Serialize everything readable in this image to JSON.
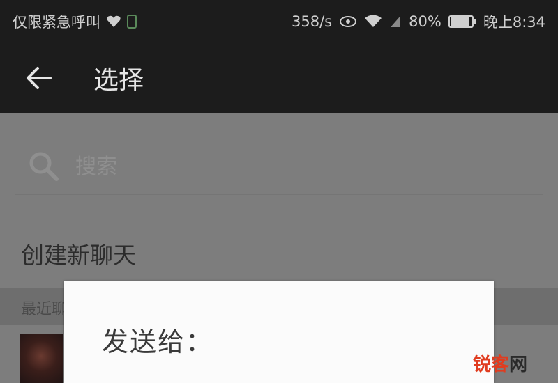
{
  "status_bar": {
    "carrier": "仅限紧急呼叫",
    "speed": "358/s",
    "battery": "80%",
    "time": "晚上8:34"
  },
  "app_bar": {
    "title": "选择"
  },
  "search": {
    "placeholder": "搜索"
  },
  "list": {
    "create_new_chat": "创建新聊天",
    "section_label": "最近聊天"
  },
  "dialog": {
    "title": "发送给："
  },
  "watermark": {
    "part1": "锐客",
    "part2": "网"
  },
  "colors": {
    "topbar": "#1c1c1c",
    "overlay": "#7c7c7c",
    "dialog": "#fbfbfb",
    "watermark_red": "#e03c1f"
  },
  "icons": [
    "shield-heart-icon",
    "sim-icon",
    "eye-icon",
    "wifi-icon",
    "signal-icon",
    "battery-icon",
    "back-arrow-icon",
    "search-icon"
  ]
}
